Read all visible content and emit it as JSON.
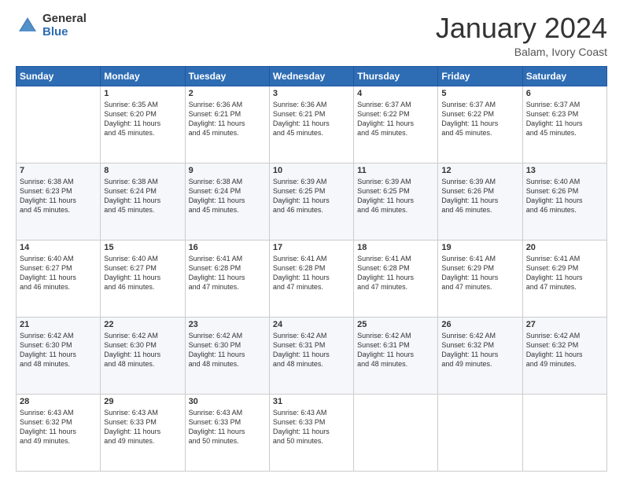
{
  "header": {
    "logo_general": "General",
    "logo_blue": "Blue",
    "month_title": "January 2024",
    "location": "Balam, Ivory Coast"
  },
  "days_of_week": [
    "Sunday",
    "Monday",
    "Tuesday",
    "Wednesday",
    "Thursday",
    "Friday",
    "Saturday"
  ],
  "weeks": [
    [
      {
        "day": "",
        "info": ""
      },
      {
        "day": "1",
        "info": "Sunrise: 6:35 AM\nSunset: 6:20 PM\nDaylight: 11 hours\nand 45 minutes."
      },
      {
        "day": "2",
        "info": "Sunrise: 6:36 AM\nSunset: 6:21 PM\nDaylight: 11 hours\nand 45 minutes."
      },
      {
        "day": "3",
        "info": "Sunrise: 6:36 AM\nSunset: 6:21 PM\nDaylight: 11 hours\nand 45 minutes."
      },
      {
        "day": "4",
        "info": "Sunrise: 6:37 AM\nSunset: 6:22 PM\nDaylight: 11 hours\nand 45 minutes."
      },
      {
        "day": "5",
        "info": "Sunrise: 6:37 AM\nSunset: 6:22 PM\nDaylight: 11 hours\nand 45 minutes."
      },
      {
        "day": "6",
        "info": "Sunrise: 6:37 AM\nSunset: 6:23 PM\nDaylight: 11 hours\nand 45 minutes."
      }
    ],
    [
      {
        "day": "7",
        "info": "Sunrise: 6:38 AM\nSunset: 6:23 PM\nDaylight: 11 hours\nand 45 minutes."
      },
      {
        "day": "8",
        "info": "Sunrise: 6:38 AM\nSunset: 6:24 PM\nDaylight: 11 hours\nand 45 minutes."
      },
      {
        "day": "9",
        "info": "Sunrise: 6:38 AM\nSunset: 6:24 PM\nDaylight: 11 hours\nand 45 minutes."
      },
      {
        "day": "10",
        "info": "Sunrise: 6:39 AM\nSunset: 6:25 PM\nDaylight: 11 hours\nand 46 minutes."
      },
      {
        "day": "11",
        "info": "Sunrise: 6:39 AM\nSunset: 6:25 PM\nDaylight: 11 hours\nand 46 minutes."
      },
      {
        "day": "12",
        "info": "Sunrise: 6:39 AM\nSunset: 6:26 PM\nDaylight: 11 hours\nand 46 minutes."
      },
      {
        "day": "13",
        "info": "Sunrise: 6:40 AM\nSunset: 6:26 PM\nDaylight: 11 hours\nand 46 minutes."
      }
    ],
    [
      {
        "day": "14",
        "info": "Sunrise: 6:40 AM\nSunset: 6:27 PM\nDaylight: 11 hours\nand 46 minutes."
      },
      {
        "day": "15",
        "info": "Sunrise: 6:40 AM\nSunset: 6:27 PM\nDaylight: 11 hours\nand 46 minutes."
      },
      {
        "day": "16",
        "info": "Sunrise: 6:41 AM\nSunset: 6:28 PM\nDaylight: 11 hours\nand 47 minutes."
      },
      {
        "day": "17",
        "info": "Sunrise: 6:41 AM\nSunset: 6:28 PM\nDaylight: 11 hours\nand 47 minutes."
      },
      {
        "day": "18",
        "info": "Sunrise: 6:41 AM\nSunset: 6:28 PM\nDaylight: 11 hours\nand 47 minutes."
      },
      {
        "day": "19",
        "info": "Sunrise: 6:41 AM\nSunset: 6:29 PM\nDaylight: 11 hours\nand 47 minutes."
      },
      {
        "day": "20",
        "info": "Sunrise: 6:41 AM\nSunset: 6:29 PM\nDaylight: 11 hours\nand 47 minutes."
      }
    ],
    [
      {
        "day": "21",
        "info": "Sunrise: 6:42 AM\nSunset: 6:30 PM\nDaylight: 11 hours\nand 48 minutes."
      },
      {
        "day": "22",
        "info": "Sunrise: 6:42 AM\nSunset: 6:30 PM\nDaylight: 11 hours\nand 48 minutes."
      },
      {
        "day": "23",
        "info": "Sunrise: 6:42 AM\nSunset: 6:30 PM\nDaylight: 11 hours\nand 48 minutes."
      },
      {
        "day": "24",
        "info": "Sunrise: 6:42 AM\nSunset: 6:31 PM\nDaylight: 11 hours\nand 48 minutes."
      },
      {
        "day": "25",
        "info": "Sunrise: 6:42 AM\nSunset: 6:31 PM\nDaylight: 11 hours\nand 48 minutes."
      },
      {
        "day": "26",
        "info": "Sunrise: 6:42 AM\nSunset: 6:32 PM\nDaylight: 11 hours\nand 49 minutes."
      },
      {
        "day": "27",
        "info": "Sunrise: 6:42 AM\nSunset: 6:32 PM\nDaylight: 11 hours\nand 49 minutes."
      }
    ],
    [
      {
        "day": "28",
        "info": "Sunrise: 6:43 AM\nSunset: 6:32 PM\nDaylight: 11 hours\nand 49 minutes."
      },
      {
        "day": "29",
        "info": "Sunrise: 6:43 AM\nSunset: 6:33 PM\nDaylight: 11 hours\nand 49 minutes."
      },
      {
        "day": "30",
        "info": "Sunrise: 6:43 AM\nSunset: 6:33 PM\nDaylight: 11 hours\nand 50 minutes."
      },
      {
        "day": "31",
        "info": "Sunrise: 6:43 AM\nSunset: 6:33 PM\nDaylight: 11 hours\nand 50 minutes."
      },
      {
        "day": "",
        "info": ""
      },
      {
        "day": "",
        "info": ""
      },
      {
        "day": "",
        "info": ""
      }
    ]
  ]
}
